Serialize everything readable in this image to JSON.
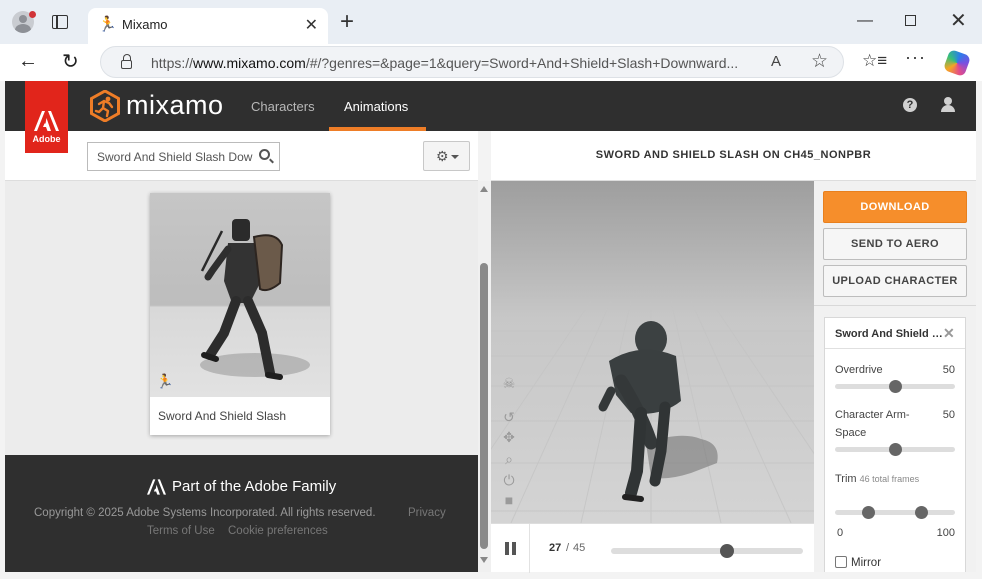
{
  "browser": {
    "tab_title": "Mixamo",
    "tab_favicon_icon": "mixamo-runner-icon",
    "url_prefix": "https://",
    "url_domain": "www.mixamo.com",
    "url_rest": "/#/?genres=&page=1&query=Sword+And+Shield+Slash+Downward...",
    "read_aloud_label": "Á)"
  },
  "header": {
    "adobe_label": "Adobe",
    "logo_text": "mixamo",
    "nav": [
      {
        "label": "Characters"
      },
      {
        "label": "Animations",
        "active": true
      }
    ],
    "accent_color": "#ee7d27"
  },
  "search": {
    "value": "Sword And Shield Slash Downward",
    "placeholder": "Search"
  },
  "results": [
    {
      "title": "Sword And Shield Slash"
    }
  ],
  "footer": {
    "family": "Part of the Adobe Family",
    "copyright": "Copyright © 2025 Adobe Systems Incorporated. All rights reserved.",
    "privacy": "Privacy",
    "terms": "Terms of Use",
    "cookies": "Cookie preferences"
  },
  "viewer": {
    "title": "SWORD AND SHIELD SLASH ON CH45_NONPBR",
    "frame_current": "27",
    "frame_separator": "/",
    "frame_total": "45",
    "progress_fraction": 0.6
  },
  "actions": {
    "download": "DOWNLOAD",
    "send_to_aero": "SEND TO AERO",
    "upload_character": "UPLOAD CHARACTER",
    "download_color": "#f68e2b"
  },
  "settings": {
    "title": "Sword And Shield Slash",
    "overdrive_label": "Overdrive",
    "overdrive_value": "50",
    "overdrive_fraction": 0.5,
    "arm_space_label": "Character Arm-Space",
    "arm_space_value": "50",
    "arm_space_fraction": 0.5,
    "trim_label": "Trim",
    "trim_sub": "46 total frames",
    "trim_min": "0",
    "trim_max": "100",
    "trim_start_fraction": 0.28,
    "trim_end_fraction": 0.72,
    "mirror_label": "Mirror",
    "mirror_checked": false
  }
}
